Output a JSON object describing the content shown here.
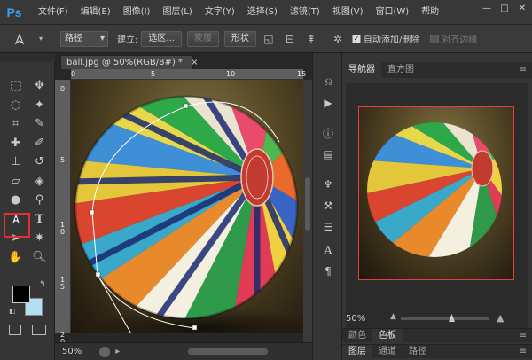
{
  "app": {
    "logo": "Ps"
  },
  "menu": [
    "文件(F)",
    "编辑(E)",
    "图像(I)",
    "图层(L)",
    "文字(Y)",
    "选择(S)",
    "滤镜(T)",
    "视图(V)",
    "窗口(W)",
    "帮助"
  ],
  "window_buttons": {
    "minimize": "—",
    "maximize": "□",
    "close": "✕"
  },
  "options": {
    "mode_select": "路径",
    "build_label": "建立:",
    "selection_btn": "选区...",
    "mask_btn": "蒙版",
    "shape_btn": "形状",
    "auto_add_delete": {
      "label": "自动添加/删除",
      "checked": true
    },
    "align_edges": {
      "label": "对齐边缘",
      "checked": false
    }
  },
  "document": {
    "tab_title": "ball.jpg @ 50%(RGB/8#) *",
    "tab_close": "×",
    "zoom": "50%",
    "ruler_h_ticks": [
      "0",
      "5",
      "10",
      "15"
    ],
    "ruler_v_ticks": [
      "0",
      "5",
      "1\n0",
      "1\n5",
      "2\n0"
    ]
  },
  "navigator": {
    "tabs": [
      "导航器",
      "直方图"
    ],
    "zoom": "50%"
  },
  "bottom_panels": {
    "row1": [
      "颜色",
      "色板"
    ],
    "row2": [
      "图层",
      "通道",
      "路径"
    ]
  },
  "colors": {
    "foreground": "#000000",
    "background": "#b4dff3",
    "selected_tool_highlight": "#e03030",
    "ps_blue": "#33a3f3"
  }
}
